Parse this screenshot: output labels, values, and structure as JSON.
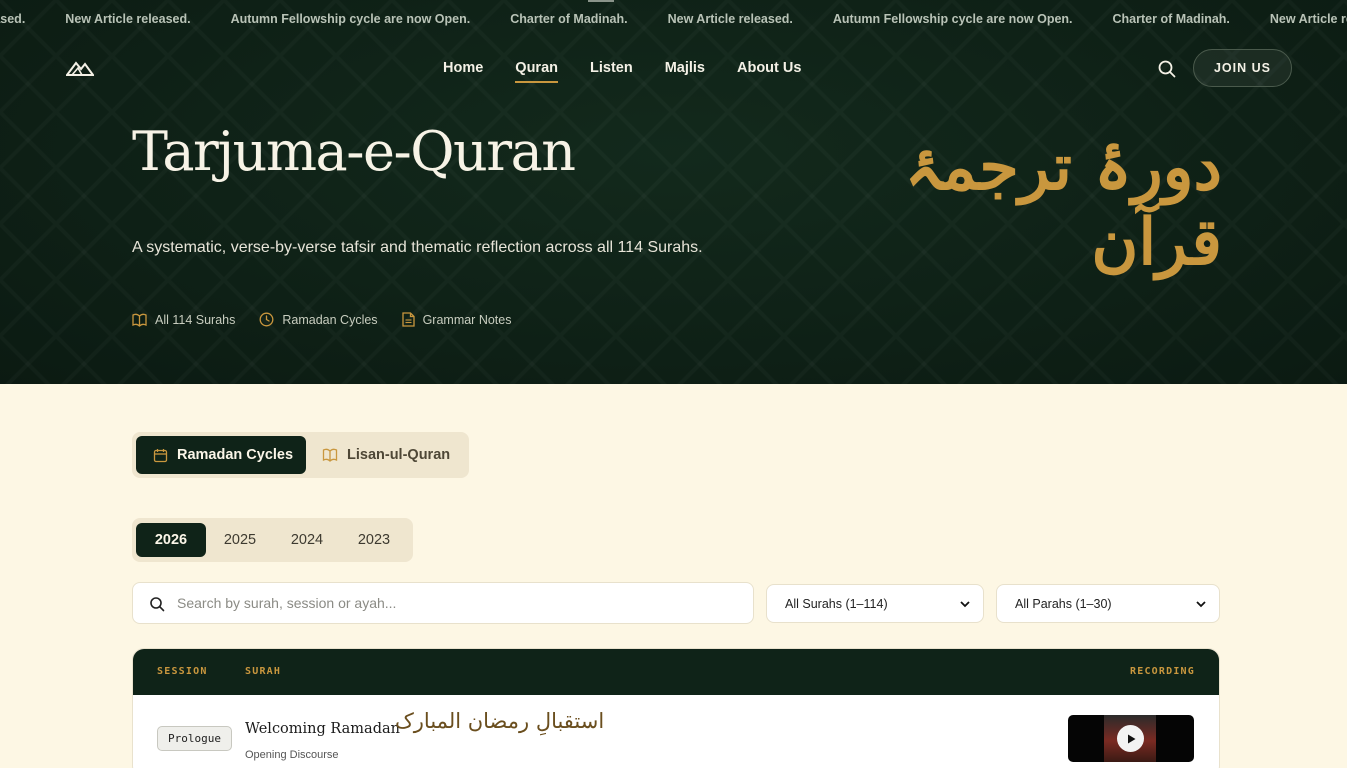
{
  "ticker": {
    "items": [
      "New Article released.",
      "Autumn Fellowship cycle are now Open.",
      "Charter of Madinah.",
      "New Article released.",
      "Autumn Fellowship cycle are now Open.",
      "Charter of Madinah.",
      "New Article released."
    ]
  },
  "nav": {
    "links": [
      "Home",
      "Quran",
      "Listen",
      "Majlis",
      "About Us"
    ],
    "active": "Quran",
    "join_label": "JOIN US"
  },
  "hero": {
    "title": "Tarjuma-e-Quran",
    "title_urdu": "دورۂ ترجمۂ قرآن",
    "subtitle": "A systematic, verse-by-verse tafsir and thematic reflection across all 114 Surahs.",
    "meta": [
      "All 114 Surahs",
      "Ramadan Cycles",
      "Grammar Notes"
    ]
  },
  "cycle_tabs": [
    "Ramadan Cycles",
    "Lisan-ul-Quran"
  ],
  "years": [
    "2026",
    "2025",
    "2024",
    "2023"
  ],
  "active_year": "2026",
  "filters": {
    "search_placeholder": "Search by surah, session or ayah...",
    "surah_select": "All Surahs (1–114)",
    "parah_select": "All Parahs (1–30)"
  },
  "table": {
    "headers": {
      "session": "SESSION",
      "surah": "SURAH",
      "recording": "RECORDING"
    },
    "rows": [
      {
        "badge": "Prologue",
        "title": "Welcoming Ramadan",
        "title_urdu": "استقبالِ رمضان المبارک",
        "subtitle": "Opening Discourse"
      }
    ]
  },
  "colors": {
    "hero_bg": "#0f2318",
    "accent_gold": "#c9973e",
    "cream_bg": "#fdf7e4"
  }
}
